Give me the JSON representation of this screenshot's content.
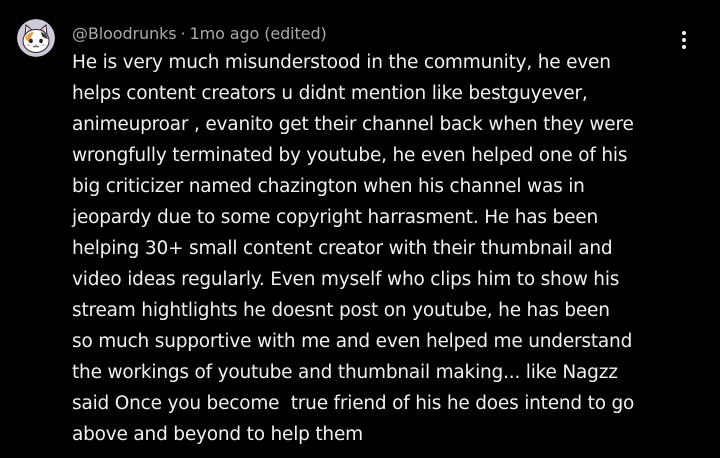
{
  "comment": {
    "author": "@Bloodrunks",
    "separator": "·",
    "timestamp": "1mo ago",
    "edited": "(edited)",
    "menu_icon": "more-vert-icon",
    "avatar_icon": "cat-avatar-icon",
    "body_lines": [
      "He is very much misunderstood in the community, he even",
      "helps content creators u didnt mention like bestguyever,",
      "animeuproar , evanito get their channel back when they were",
      "wrongfully terminated by youtube, he even helped one of his",
      "big criticizer named chazington when his channel was in",
      "jeopardy due to some copyright harrasment. He has been",
      "helping 30+ small content creator with their thumbnail and",
      "video ideas regularly. Even myself who clips him to show his",
      "stream hightlights he doesnt post on youtube, he has been",
      "so much supportive with me and even helped me understand",
      "the workings of youtube and thumbnail making... like Nagzz",
      "said Once you become  true friend of his he does intend to go",
      "above and beyond to help them"
    ]
  },
  "colors": {
    "background": "#000000",
    "text": "#f1f1f1",
    "meta_text": "#aaaaaa"
  }
}
